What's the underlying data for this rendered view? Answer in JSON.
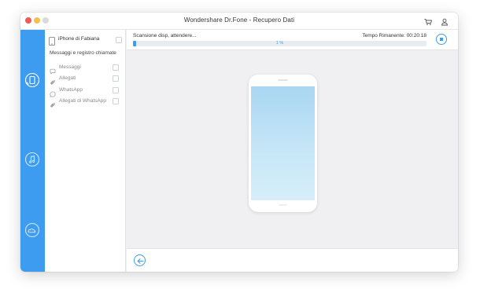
{
  "window": {
    "title": "Wondershare Dr.Fone - Recupero Dati"
  },
  "titlebar_icons": {
    "cart": "cart-icon",
    "account": "user-icon"
  },
  "rail": {
    "items": [
      {
        "icon": "device-recovery-icon",
        "active": true
      },
      {
        "icon": "itunes-recovery-icon",
        "active": false
      },
      {
        "icon": "icloud-recovery-icon",
        "active": false
      }
    ]
  },
  "sidebar": {
    "device_name": "iPhone di Fabiana",
    "category_label": "Messaggi e registro chiamate",
    "items": [
      {
        "label": "Messaggi",
        "icon": "message-icon"
      },
      {
        "label": "Allegati",
        "icon": "paperclip-icon"
      },
      {
        "label": "WhatsApp",
        "icon": "whatsapp-icon"
      },
      {
        "label": "Allegati di WhatsApp",
        "icon": "paperclip-icon"
      }
    ]
  },
  "scan": {
    "status_text": "Scansione disp, attendere...",
    "time_remaining": "Tempo Rimanente: 00:20:18",
    "progress_label": "1 %",
    "progress_fraction": 0.01
  },
  "colors": {
    "accent": "#3e9cf0",
    "rail_bg": "#3e9cf0",
    "phone_screen_top": "#a9d6f2"
  }
}
